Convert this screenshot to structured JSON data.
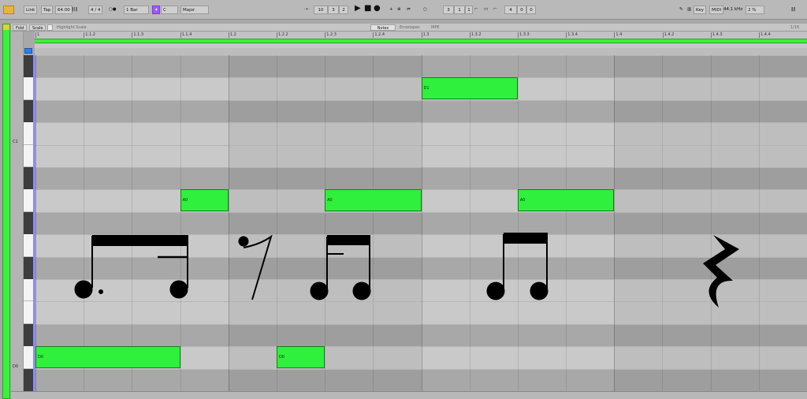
{
  "transport": {
    "link": "Link",
    "tap": "Tap",
    "tempo": "64.00",
    "time_signature": "4 / 4",
    "quantize": "1 Bar",
    "key": "C",
    "scale": "Major",
    "position_bar": "10",
    "position_beat": "3",
    "position_sixteenth": "2",
    "loop_bar": "3",
    "loop_beat": "1",
    "loop_sixteenth": "1",
    "length_bar": "4",
    "length_beat": "0",
    "length_sixteenth": "0",
    "key_map": "Key",
    "midi_map": "MIDI",
    "sample_rate": "44.1 kHz",
    "cpu": "2 %"
  },
  "clip_header": {
    "fold": "Fold",
    "scale": "Scale",
    "highlight_scale": "Highlight Scale",
    "tabs": [
      "Notes",
      "Envelopes",
      "MPE"
    ],
    "active_tab": "Notes",
    "grid": "1/16"
  },
  "ruler_ticks": [
    "1",
    "1.1.2",
    "1.1.3",
    "1.1.4",
    "1.2",
    "1.2.2",
    "1.2.3",
    "1.2.4",
    "1.3",
    "1.3.2",
    "1.3.3",
    "1.3.4",
    "1.4",
    "1.4.2",
    "1.4.3",
    "1.4.4"
  ],
  "key_labels": {
    "c1": "C1",
    "d0": "D0"
  },
  "notes": [
    {
      "pitch": "D1",
      "start": 8,
      "length": 2
    },
    {
      "pitch": "A0",
      "start": 3,
      "length": 1
    },
    {
      "pitch": "A0",
      "start": 6,
      "length": 2
    },
    {
      "pitch": "A0",
      "start": 10,
      "length": 2
    },
    {
      "pitch": "D0",
      "start": 0,
      "length": 3
    },
    {
      "pitch": "D0",
      "start": 5,
      "length": 1
    }
  ],
  "colors": {
    "note": "#2ff03c",
    "loop": "#3cf03c",
    "accent": "#9b5cf0",
    "marker": "#2f7cf0"
  },
  "icons": [
    "play-icon",
    "stop-icon",
    "record-icon",
    "metronome-icon",
    "loop-icon",
    "follow-icon"
  ]
}
